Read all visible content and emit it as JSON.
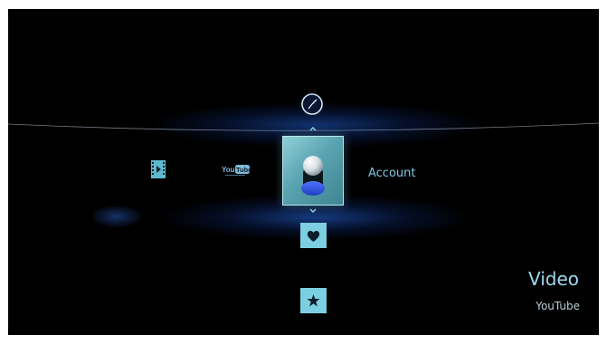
{
  "menu": {
    "focused_item": {
      "label": "Account",
      "icon": "user-avatar-icon"
    },
    "left_items": [
      {
        "icon": "film-icon"
      },
      {
        "icon": "youtube-logo",
        "logo_text": "YouTube"
      }
    ],
    "above_item": {
      "icon": "clock-icon"
    },
    "below_items": [
      {
        "icon": "heart-icon"
      },
      {
        "icon": "star-icon"
      }
    ]
  },
  "category": {
    "title": "Video",
    "subtitle": "YouTube"
  },
  "colors": {
    "accent": "#7ccfe0",
    "label": "#7ec8e6",
    "glow": "#1e5ac8",
    "background": "#000000"
  }
}
